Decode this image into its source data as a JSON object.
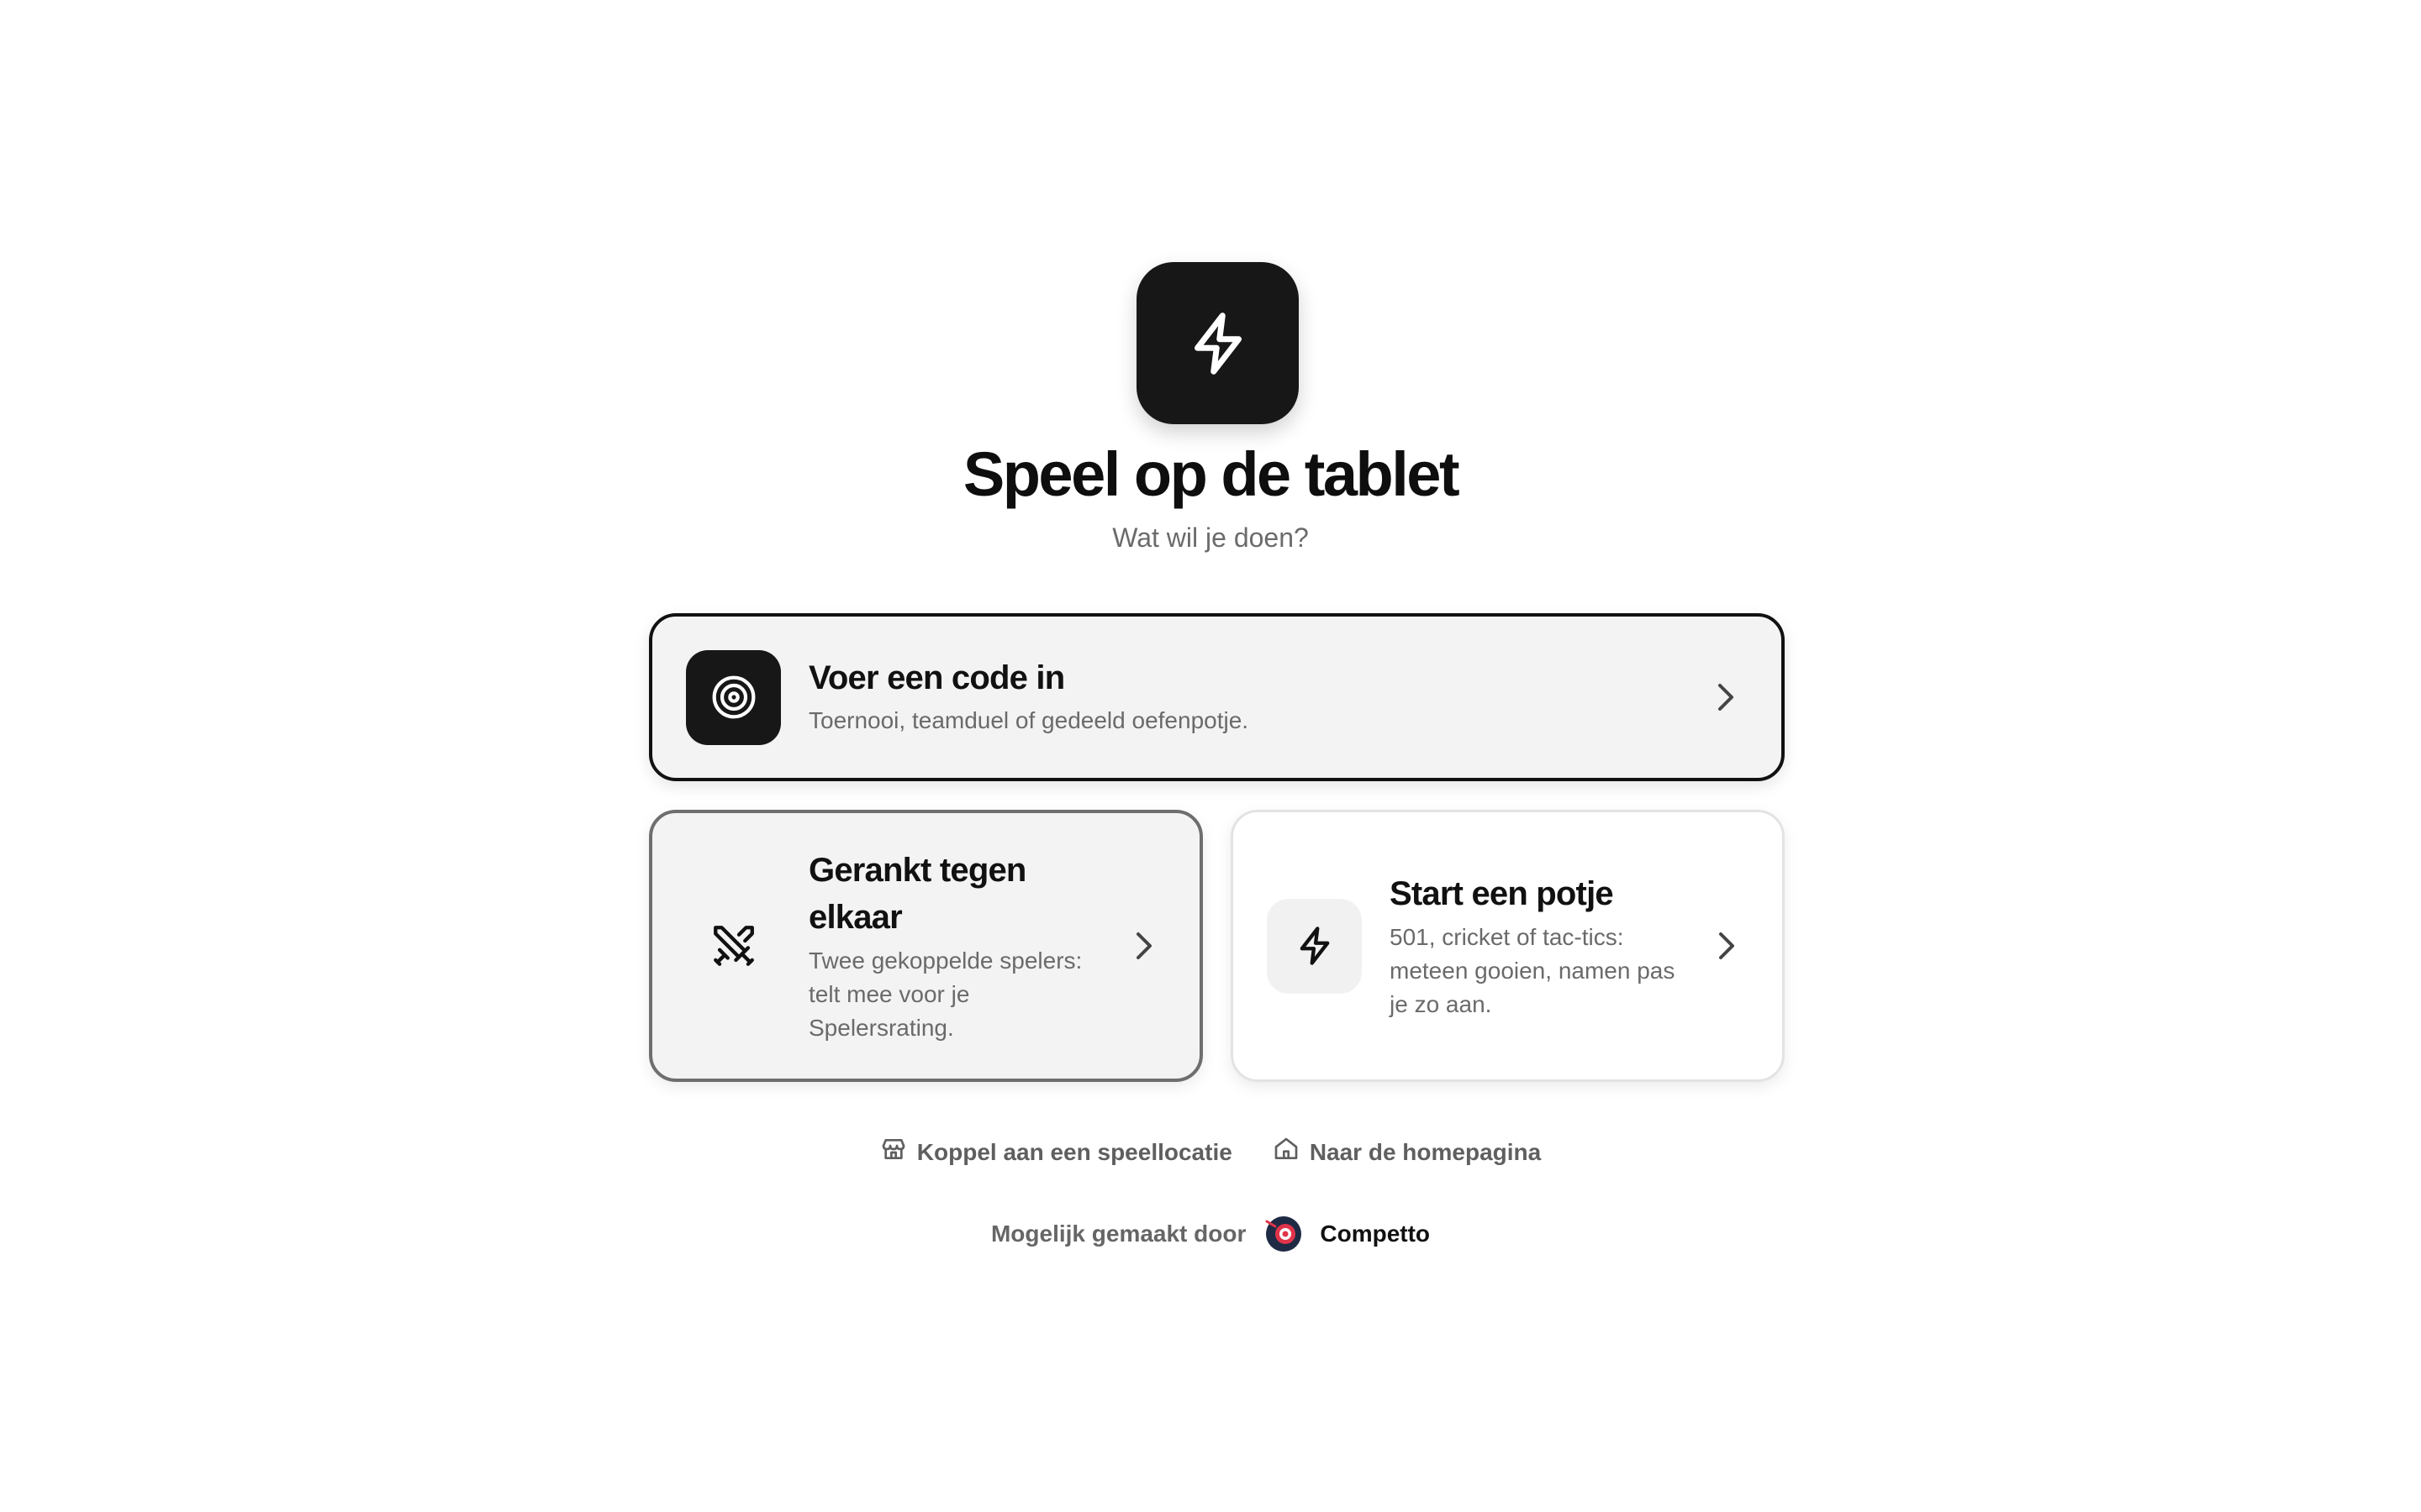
{
  "hero": {
    "icon": "lightning-bolt-icon",
    "title": "Speel op de tablet",
    "subtitle": "Wat wil je doen?"
  },
  "cards": {
    "code": {
      "icon": "target-icon",
      "title": "Voer een code in",
      "description": "Toernooi, teamduel of gedeeld oefenpotje."
    },
    "ranked": {
      "icon": "crossed-swords-icon",
      "title": "Gerankt tegen elkaar",
      "description": "Twee gekoppelde spelers: telt mee voor je Spelersrating."
    },
    "start": {
      "icon": "lightning-bolt-icon",
      "title": "Start een potje",
      "description": "501, cricket of tac-tics: meteen gooien, namen pas je zo aan."
    }
  },
  "links": {
    "location": {
      "icon": "store-icon",
      "label": "Koppel aan een speellocatie"
    },
    "home": {
      "icon": "home-icon",
      "label": "Naar de homepagina"
    }
  },
  "footer": {
    "label": "Mogelijk gemaakt door",
    "brand": "Competto",
    "brand_icon": "competto-logo"
  },
  "colors": {
    "dark": "#171717",
    "card_bg": "#f3f3f3",
    "muted_text": "#6a6a6a",
    "brand_navy": "#1f2a44",
    "brand_red": "#e0344a"
  }
}
